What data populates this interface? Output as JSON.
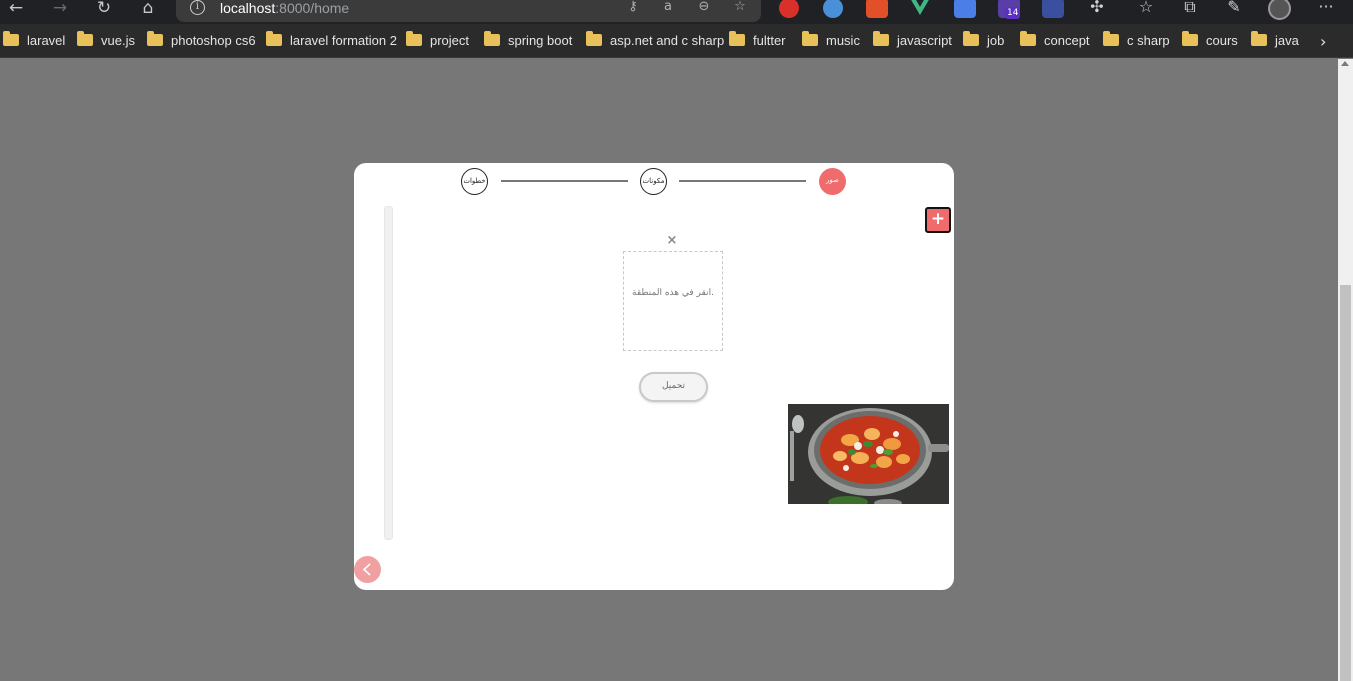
{
  "browser": {
    "url_host": "localhost",
    "url_path": ":8000/home",
    "extension_badge": "14"
  },
  "bookmarks": [
    "laravel",
    "vue.js",
    "photoshop cs6",
    "laravel formation 2",
    "project",
    "spring boot",
    "asp.net and c sharp",
    "fultter",
    "music",
    "javascript",
    "job",
    "concept",
    "c sharp",
    "cours",
    "java"
  ],
  "modal": {
    "steps": [
      {
        "label": "خطوات"
      },
      {
        "label": "مكونات"
      },
      {
        "label": "صور"
      }
    ],
    "active_step": 3,
    "add_label": "+",
    "close_label": "×",
    "dropzone_hint": "انقر في هذه المنطقة.",
    "upload_label": "تحميل"
  },
  "colors": {
    "accent": "#f06b6b",
    "backdrop": "#777777"
  }
}
